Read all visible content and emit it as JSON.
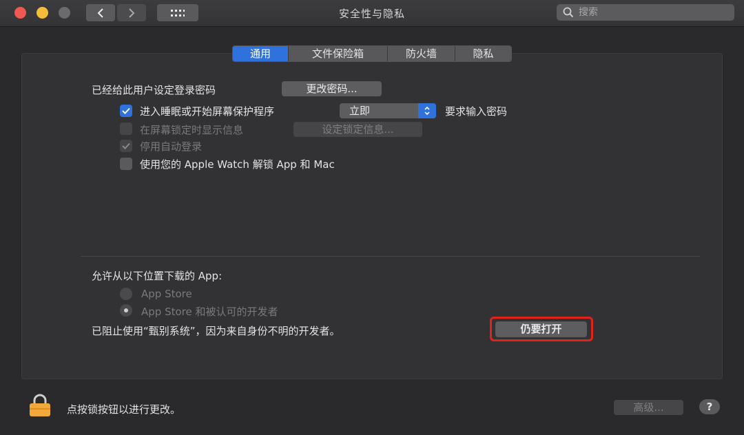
{
  "window": {
    "title": "安全性与隐私",
    "search_placeholder": "搜索"
  },
  "tabs": [
    {
      "label": "通用",
      "active": true
    },
    {
      "label": "文件保险箱",
      "active": false
    },
    {
      "label": "防火墙",
      "active": false
    },
    {
      "label": "隐私",
      "active": false
    }
  ],
  "general": {
    "password_label": "已经给此用户设定登录密码",
    "change_password_button": "更改密码...",
    "require_password": {
      "label_before": "进入睡眠或开始屏幕保护程序",
      "select_value": "立即",
      "label_after": "要求输入密码",
      "checked": true
    },
    "lock_message": {
      "label": "在屏幕锁定时显示信息",
      "button": "设定锁定信息...",
      "checked": false,
      "enabled": false
    },
    "disable_auto_login": {
      "label": "停用自动登录",
      "checked": true,
      "enabled": false
    },
    "apple_watch": {
      "label": "使用您的 Apple Watch 解锁 App 和 Mac",
      "checked": false
    }
  },
  "downloads": {
    "heading": "允许从以下位置下载的 App:",
    "options": [
      {
        "label": "App Store",
        "selected": false
      },
      {
        "label": "App Store 和被认可的开发者",
        "selected": true
      }
    ],
    "blocked_message": "已阻止使用“甄别系统”，因为来自身份不明的开发者。",
    "open_anyway_button": "仍要打开"
  },
  "footer": {
    "lock_message": "点按锁按钮以进行更改。",
    "advanced_button": "高级...",
    "help_label": "?"
  },
  "colors": {
    "accent": "#2f72de",
    "highlight": "#e2231a",
    "lock": "#f2a93b"
  }
}
